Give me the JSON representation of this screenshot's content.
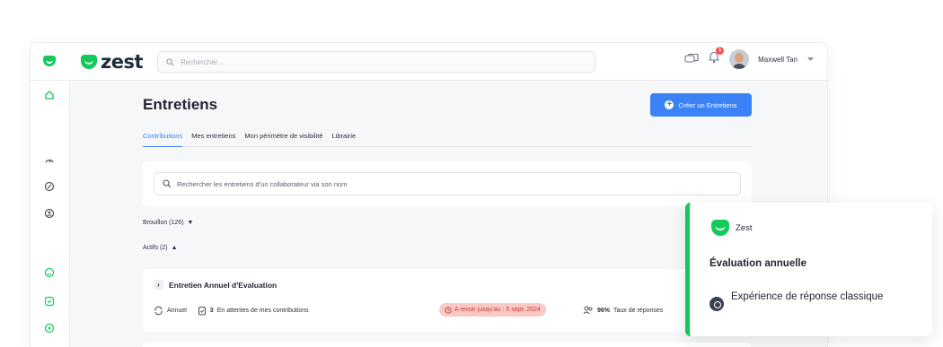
{
  "app": {
    "brand": "zest",
    "search_placeholder": "Rechercher...",
    "user_name": "Maxwell Tan",
    "notification_count": "1",
    "colors": {
      "brand_green": "#12c95a",
      "accent_blue": "#3b82f6",
      "deadline_bg": "#f8c9c5",
      "deadline_text": "#c43b34"
    }
  },
  "sidebar": {
    "icons": [
      "home-icon",
      "gauge-icon",
      "compass-icon",
      "search-person-icon",
      "smile-icon",
      "check-icon",
      "play-icon"
    ]
  },
  "main": {
    "title": "Entretiens",
    "create_button": "Créer un Entretiens",
    "tabs": [
      {
        "label": "Contributions",
        "active": true
      },
      {
        "label": "Mes entretiens",
        "active": false
      },
      {
        "label": "Mon périmètre de visibilité",
        "active": false
      },
      {
        "label": "Librairie",
        "active": false
      }
    ],
    "collab_search_placeholder": "Rechercher les entretiens d'un collaborateur via son nom",
    "draft_group": "Brouillon (126)",
    "active_group": "Actifs (2)",
    "entretien": {
      "title": "Entretien Annuel d'Evaluation",
      "frequency": "Annuel",
      "pending_count": "3",
      "pending_label": "En attentes de mes contributions",
      "deadline": "A revoir jusqu'au : 5 sept. 2024",
      "response_rate": "96%",
      "response_label": "Taux de réponses"
    }
  },
  "overlay": {
    "brand": "Zest",
    "title": "Évaluation annuelle",
    "subtitle": "Expérience de réponse classique"
  }
}
